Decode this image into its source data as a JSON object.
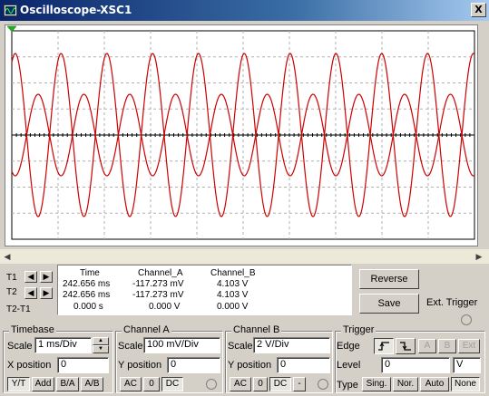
{
  "window": {
    "title": "Oscilloscope-XSC1",
    "close_glyph": "X"
  },
  "readout": {
    "headers": {
      "time": "Time",
      "channel_a": "Channel_A",
      "channel_b": "Channel_B"
    },
    "rows": [
      {
        "label": "T1",
        "time": "242.656 ms",
        "channel_a": "-117.273 mV",
        "channel_b": "4.103 V"
      },
      {
        "label": "T2",
        "time": "242.656 ms",
        "channel_a": "-117.273 mV",
        "channel_b": "4.103 V"
      },
      {
        "label": "T2-T1",
        "time": "0.000 s",
        "channel_a": "0.000 V",
        "channel_b": "0.000 V"
      }
    ]
  },
  "buttons": {
    "reverse": "Reverse",
    "save": "Save",
    "ext_trigger": "Ext. Trigger"
  },
  "timebase": {
    "title": "Timebase",
    "scale_label": "Scale",
    "scale_value": "1 ms/Div",
    "xpos_label": "X position",
    "xpos_value": "0",
    "modes": [
      "Y/T",
      "Add",
      "B/A",
      "A/B"
    ]
  },
  "channel_a": {
    "title": "Channel A",
    "scale_label": "Scale",
    "scale_value": "100 mV/Div",
    "ypos_label": "Y position",
    "ypos_value": "0",
    "coupling": [
      "AC",
      "0",
      "DC"
    ]
  },
  "channel_b": {
    "title": "Channel B",
    "scale_label": "Scale",
    "scale_value": "2  V/Div",
    "ypos_label": "Y position",
    "ypos_value": "0",
    "coupling": [
      "AC",
      "0",
      "DC",
      "-"
    ]
  },
  "trigger": {
    "title": "Trigger",
    "edge_label": "Edge",
    "level_label": "Level",
    "level_value": "0",
    "level_unit": "V",
    "sources": [
      "A",
      "B",
      "Ext"
    ],
    "type_label": "Type",
    "types": [
      "Sing.",
      "Nor.",
      "Auto",
      "None"
    ]
  },
  "colors": {
    "trace": "#cc0000",
    "grid": "#b0b0b0",
    "screen": "#ffffff",
    "title_bar": "#0a246a"
  }
}
